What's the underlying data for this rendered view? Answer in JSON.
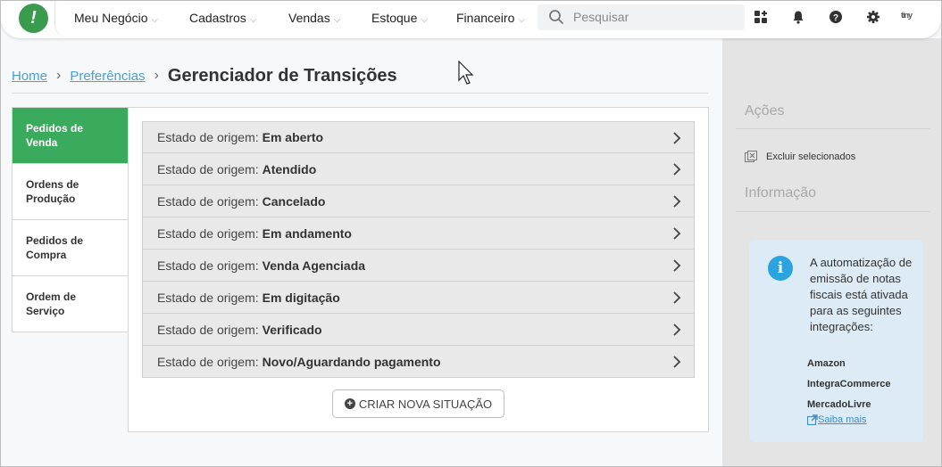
{
  "nav": {
    "items": [
      {
        "label": "Meu Negócio"
      },
      {
        "label": "Cadastros"
      },
      {
        "label": "Vendas"
      },
      {
        "label": "Estoque"
      },
      {
        "label": "Financeiro"
      }
    ],
    "search_placeholder": "Pesquisar",
    "icons": [
      "apps-icon",
      "bell-icon",
      "help-icon",
      "gear-icon",
      "company-logo-icon"
    ],
    "brand_mini": "tiny"
  },
  "breadcrumb": {
    "home": "Home",
    "prefs": "Preferências",
    "current": "Gerenciador de Transições"
  },
  "side_tabs": [
    {
      "label": "Pedidos de Venda",
      "active": true
    },
    {
      "label": "Ordens de Produção",
      "active": false
    },
    {
      "label": "Pedidos de Compra",
      "active": false
    },
    {
      "label": "Ordem de Serviço",
      "active": false
    }
  ],
  "rows": {
    "label": "Estado de origem:",
    "items": [
      {
        "value": "Em aberto"
      },
      {
        "value": "Atendido"
      },
      {
        "value": "Cancelado"
      },
      {
        "value": "Em andamento"
      },
      {
        "value": "Venda Agenciada"
      },
      {
        "value": "Em digitação"
      },
      {
        "value": "Verificado"
      },
      {
        "value": "Novo/Aguardando pagamento"
      }
    ]
  },
  "new_button": {
    "label": "CRIAR NOVA SITUAÇÃO"
  },
  "right": {
    "actions_title": "Ações",
    "delete_label": "Excluir selecionados",
    "info_title": "Informação",
    "info_text": "A automatização de emissão de notas fiscais está ativada para as seguintes integrações:",
    "integrations": [
      "Amazon",
      "IntegraCommerce",
      "MercadoLivre"
    ],
    "learn_more": "Saiba mais"
  },
  "colors": {
    "accent_green": "#3aaa5c",
    "link_blue": "#4a9fd8",
    "info_blue": "#2aa3de"
  }
}
